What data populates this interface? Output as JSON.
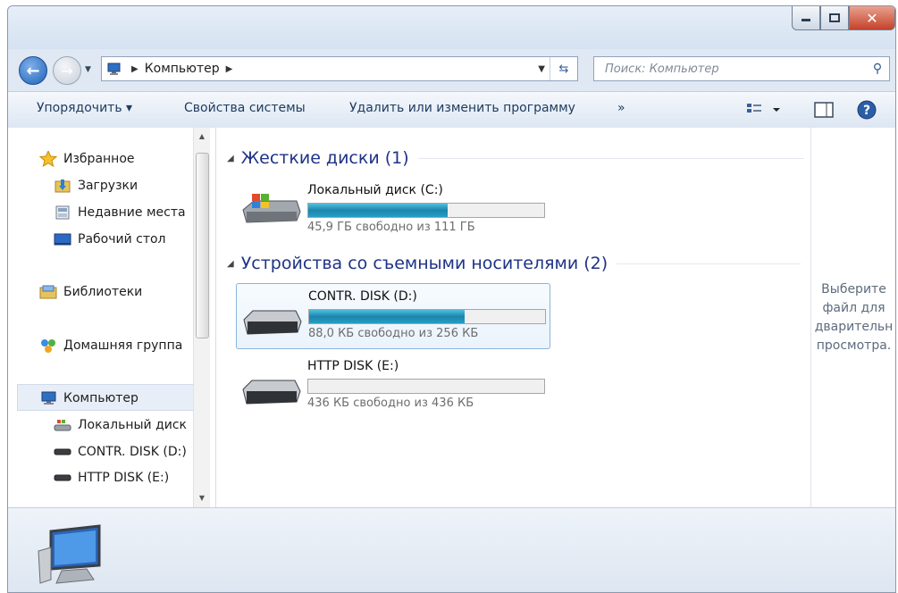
{
  "address": {
    "path": [
      "Компьютер"
    ],
    "search_placeholder": "Поиск: Компьютер"
  },
  "toolbar": {
    "organize": "Упорядочить ▾",
    "system_properties": "Свойства системы",
    "uninstall": "Удалить или изменить программу",
    "more": "»"
  },
  "nav": {
    "favorites": "Избранное",
    "downloads": "Загрузки",
    "recent": "Недавние места",
    "desktop": "Рабочий стол",
    "libraries": "Библиотеки",
    "homegroup": "Домашняя группа",
    "computer": "Компьютер",
    "local_disk": "Локальный диск",
    "contr_disk": "CONTR. DISK (D:)",
    "http_disk": "HTTP DISK (E:)"
  },
  "groups": {
    "hard_disks": "Жесткие диски (1)",
    "removable": "Устройства со съемными носителями (2)"
  },
  "drives": [
    {
      "name": "Локальный диск (C:)",
      "free_text": "45,9 ГБ свободно из 111 ГБ",
      "used_fraction": 0.59
    },
    {
      "name": "CONTR. DISK (D:)",
      "free_text": "88,0 КБ свободно из 256 КБ",
      "used_fraction": 0.66
    },
    {
      "name": "HTTP DISK (E:)",
      "free_text": "436 КБ свободно из 436 КБ",
      "used_fraction": 0.0
    }
  ],
  "preview_text": "Выберите\nфайл для\nдварительн\nпросмотра.",
  "colors": {
    "bar_fill": "#1c84ad",
    "group_header": "#1e3287"
  }
}
